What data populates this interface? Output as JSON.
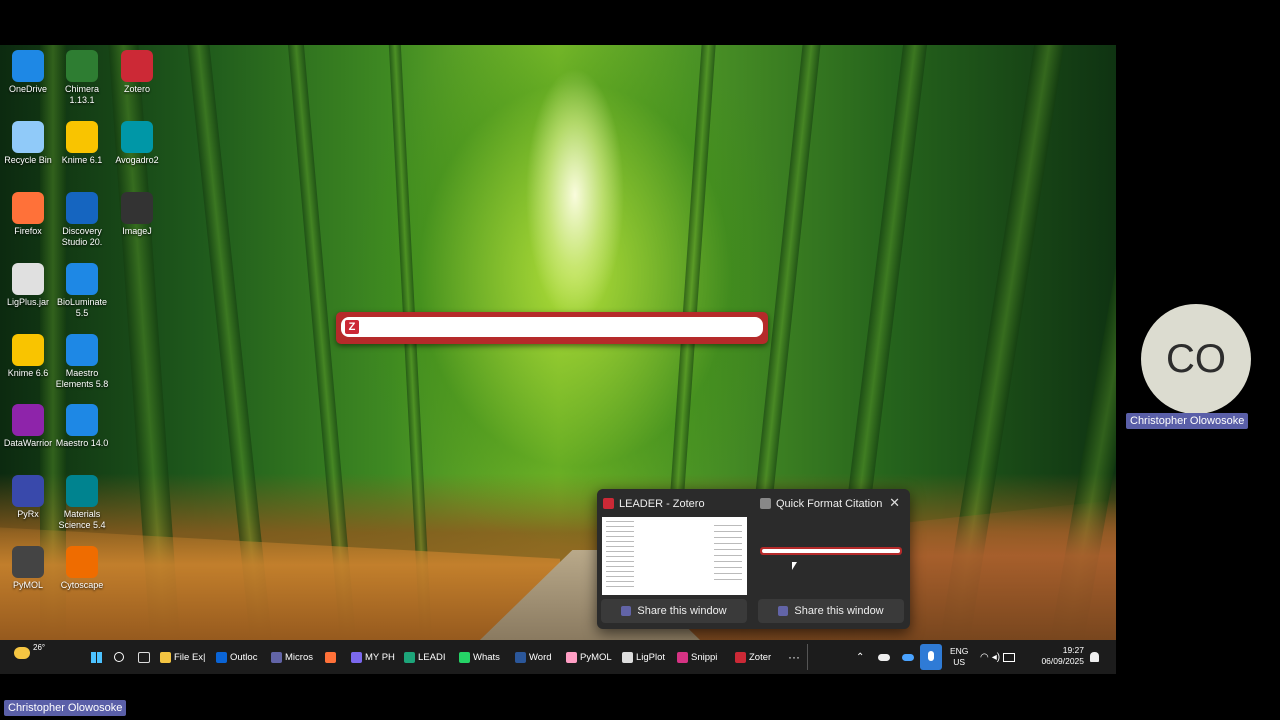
{
  "desktop_icons": [
    {
      "label": "OneDrive",
      "icon": "cloud-icon",
      "color": "#1e88e5"
    },
    {
      "label": "Chimera 1.13.1",
      "icon": "chimera-icon",
      "color": "#2e7d32"
    },
    {
      "label": "Zotero",
      "icon": "zotero-icon",
      "color": "#cc2936"
    },
    {
      "label": "Recycle Bin",
      "icon": "recycle-bin-icon",
      "color": "#90caf9"
    },
    {
      "label": "Knime 6.1",
      "icon": "knime-icon",
      "color": "#f9c400"
    },
    {
      "label": "Avogadro2",
      "icon": "avogadro-icon",
      "color": "#0097a7"
    },
    {
      "label": "Firefox",
      "icon": "firefox-icon",
      "color": "#ff7139"
    },
    {
      "label": "Discovery Studio 20.",
      "icon": "discovery-studio-icon",
      "color": "#1565c0"
    },
    {
      "label": "ImageJ",
      "icon": "imagej-icon",
      "color": "#333333"
    },
    {
      "label": "LigPlus.jar",
      "icon": "java-icon",
      "color": "#e0e0e0"
    },
    {
      "label": "BioLuminate 5.5",
      "icon": "bioluminate-icon",
      "color": "#1e88e5"
    },
    {
      "label": "Knime 6.6",
      "icon": "knime-icon",
      "color": "#f9c400"
    },
    {
      "label": "Maestro Elements 5.8",
      "icon": "maestro-elements-icon",
      "color": "#1e88e5"
    },
    {
      "label": "DataWarrior",
      "icon": "datawarrior-icon",
      "color": "#8e24aa"
    },
    {
      "label": "Maestro 14.0",
      "icon": "maestro-icon",
      "color": "#1e88e5"
    },
    {
      "label": "PyRx",
      "icon": "pyrx-icon",
      "color": "#3949ab"
    },
    {
      "label": "Materials Science 5.4",
      "icon": "materials-science-icon",
      "color": "#00838f"
    },
    {
      "label": "PyMOL",
      "icon": "pymol-icon",
      "color": "#444444"
    },
    {
      "label": "Cytoscape",
      "icon": "cytoscape-icon",
      "color": "#ef6c00"
    }
  ],
  "zotero_bar": {
    "logo": "Z",
    "placeholder": ""
  },
  "thumbnails": [
    {
      "title": "LEADER - Zotero",
      "icon_color": "#cc2936",
      "share_label": "Share this window"
    },
    {
      "title": "Quick Format Citation",
      "icon_color": "#888888",
      "share_label": "Share this window",
      "close": "✕"
    }
  ],
  "taskbar": {
    "weather": "26°",
    "apps": [
      {
        "label": "File Ex|",
        "color": "#f4c542"
      },
      {
        "label": "Outloc",
        "color": "#0a64d6"
      },
      {
        "label": "Micros",
        "color": "#6264a7"
      },
      {
        "label": "",
        "color": "#ff7139"
      },
      {
        "label": "MY PH",
        "color": "#7b68ee"
      },
      {
        "label": "LEADI",
        "color": "#1da57a"
      },
      {
        "label": "Whats",
        "color": "#25d366"
      },
      {
        "label": "Word",
        "color": "#2b579a"
      },
      {
        "label": "PyMOL",
        "color": "#ff9ec4"
      },
      {
        "label": "LigPlot",
        "color": "#dddddd"
      },
      {
        "label": "Snippi",
        "color": "#d63384"
      },
      {
        "label": "Zoter",
        "color": "#cc2936"
      }
    ],
    "more": "···",
    "language": "ENG",
    "region": "US",
    "time": "19:27",
    "date": "06/09/2025"
  },
  "participant": {
    "initials": "CO",
    "name": "Christopher Olowosoke"
  },
  "self_name": "Christopher Olowosoke"
}
